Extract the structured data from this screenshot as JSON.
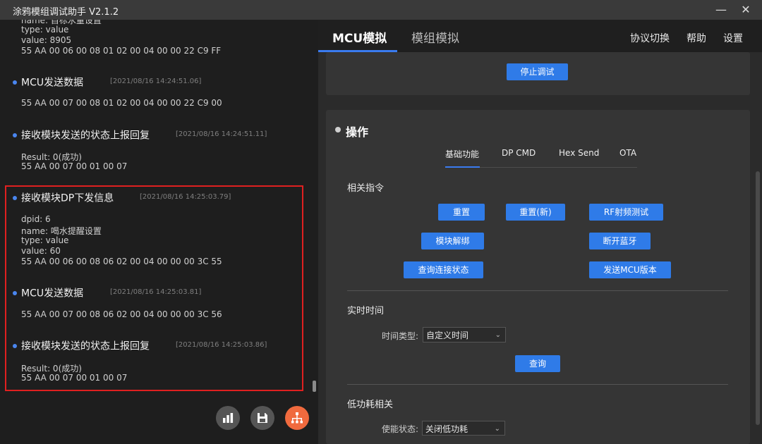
{
  "window": {
    "title": "涂鸦模组调试助手 V2.1.2",
    "minimize_icon": "minimize-icon",
    "close_icon": "close-icon"
  },
  "log": {
    "lines_top": [
      "name: 目标水量设置",
      "type: value",
      "value: 8905",
      "55 AA 00 06 00 08 01 02 00 04 00 00 22 C9 FF"
    ],
    "events": [
      {
        "name": "MCU发送数据",
        "ts": "[2021/08/16 14:24:51.06]",
        "lines": [
          "55 AA 00 07 00 08 01 02 00 04 00 00 22 C9 00"
        ]
      },
      {
        "name": "接收模块发送的状态上报回复",
        "ts": "[2021/08/16 14:24:51.11]",
        "lines": [
          "Result: 0(成功)",
          "55 AA 00 07 00 01 00 07"
        ]
      },
      {
        "name": "接收模块DP下发信息",
        "ts": "[2021/08/16 14:25:03.79]",
        "lines": [
          "dpid: 6",
          "name: 喝水提醒设置",
          "type: value",
          "value: 60",
          "55 AA 00 06 00 08 06 02 00 04 00 00 00 3C 55"
        ]
      },
      {
        "name": "MCU发送数据",
        "ts": "[2021/08/16 14:25:03.81]",
        "lines": [
          "55 AA 00 07 00 08 06 02 00 04 00 00 00 3C 56"
        ]
      },
      {
        "name": "接收模块发送的状态上报回复",
        "ts": "[2021/08/16 14:25:03.86]",
        "lines": [
          "Result: 0(成功)",
          "55 AA 00 07 00 01 00 07"
        ]
      }
    ]
  },
  "fab": {
    "chart_icon": "chart-icon",
    "save_icon": "save-icon",
    "network_icon": "network-icon"
  },
  "tabs": {
    "mcu": "MCU模拟",
    "module": "模组模拟"
  },
  "menu": {
    "protocol": "协议切换",
    "help": "帮助",
    "settings": "设置"
  },
  "debug": {
    "stop_button": "停止调试"
  },
  "ops": {
    "title": "操作",
    "subtabs": [
      "基础功能",
      "DP CMD",
      "Hex Send",
      "OTA"
    ],
    "commands_title": "相关指令",
    "buttons": {
      "reset": "重置",
      "reset_new": "重置(新)",
      "rf_test": "RF射频测试",
      "unbind": "模块解绑",
      "disconnect_bt": "断开蓝牙",
      "query_conn": "查询连接状态",
      "send_mcu_ver": "发送MCU版本"
    },
    "realtime_title": "实时时间",
    "time_type_label": "时间类型:",
    "time_type_value": "自定义时间",
    "query_button": "查询",
    "lowpower_title": "低功耗相关",
    "enable_label": "使能状态:",
    "enable_value": "关闭低功耗"
  },
  "colors": {
    "accent": "#2f7be8",
    "highlight_border": "#e02020",
    "fab_orange": "#f06a3e"
  }
}
